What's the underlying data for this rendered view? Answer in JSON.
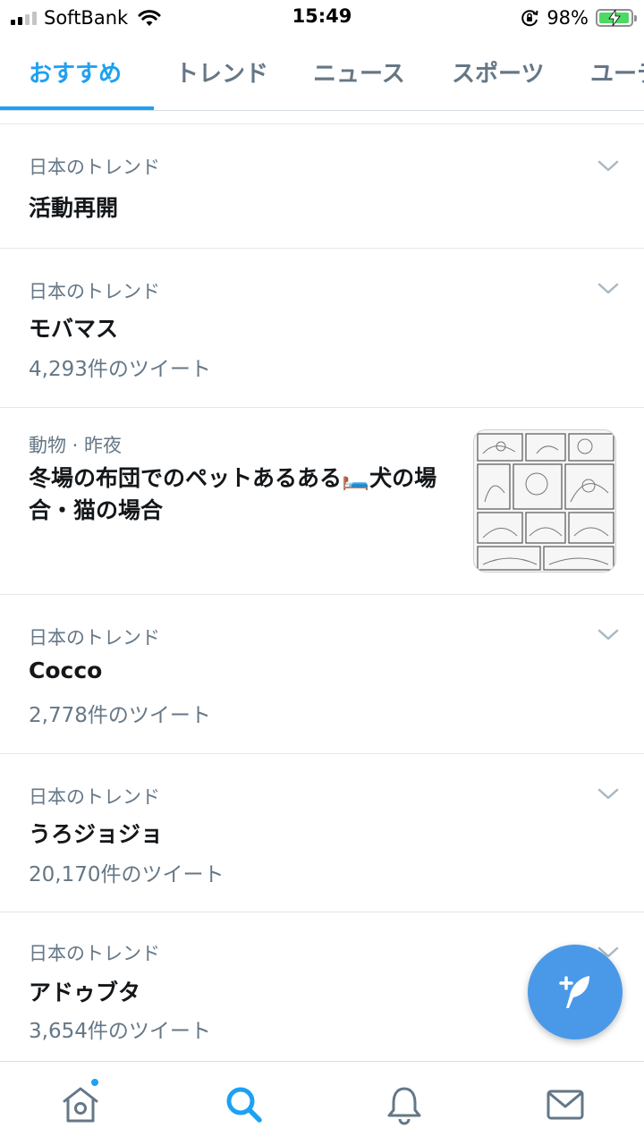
{
  "status_bar": {
    "carrier": "SoftBank",
    "time": "15:49",
    "battery_percent": "98%",
    "battery_level": 0.98
  },
  "tabs": [
    {
      "label": "おすすめ",
      "active": true
    },
    {
      "label": "トレンド",
      "active": false
    },
    {
      "label": "ニュース",
      "active": false
    },
    {
      "label": "スポーツ",
      "active": false
    },
    {
      "label": "ユーテ",
      "active": false
    }
  ],
  "trends": [
    {
      "context": "日本のトレンド",
      "title": "活動再開",
      "count": ""
    },
    {
      "context": "日本のトレンド",
      "title": "モバマス",
      "count": "4,293件のツイート"
    },
    {
      "context": "日本のトレンド",
      "title": "Cocco",
      "count": "2,778件のツイート"
    },
    {
      "context": "日本のトレンド",
      "title": "うろジョジョ",
      "count": "20,170件のツイート"
    },
    {
      "context": "日本のトレンド",
      "title": "アドゥブタ",
      "count": "3,654件のツイート"
    }
  ],
  "news": {
    "meta": "動物 · 昨夜",
    "title": "冬場の布団でのペットあるある🛏️犬の場合・猫の場合",
    "thumbnail": "manga-comic-panels"
  },
  "icons": {
    "fab": "compose-tweet-icon",
    "nav": [
      "home-icon",
      "search-icon",
      "notifications-bell-icon",
      "messages-envelope-icon"
    ]
  },
  "colors": {
    "accent": "#1da1f2",
    "fab": "#4a99e9",
    "secondary_text": "#657786",
    "battery": "#4cd964"
  }
}
